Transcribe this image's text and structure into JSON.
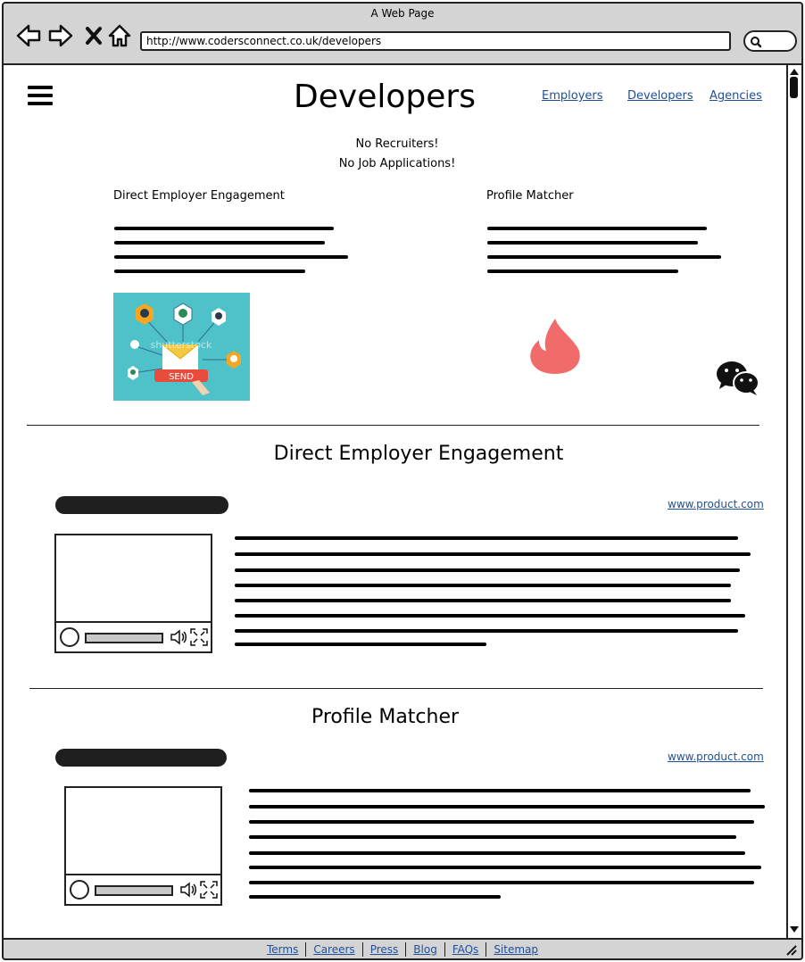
{
  "window": {
    "title": "A Web Page",
    "url": "http://www.codersconnect.co.uk/developers"
  },
  "header": {
    "title": "Developers",
    "nav": [
      "Employers",
      "Developers",
      "Agencies"
    ]
  },
  "taglines": [
    "No Recruiters!",
    "No Job Applications!"
  ],
  "features": {
    "left_heading": "Direct Employer Engagement",
    "right_heading": "Profile Matcher",
    "illustration_send_label": "SEND",
    "illustration_watermark": "shutterstock"
  },
  "sections": [
    {
      "title": "Direct Employer Engagement",
      "link": "www.product.com"
    },
    {
      "title": "Profile Matcher",
      "link": "www.product.com"
    }
  ],
  "footer": {
    "links": [
      "Terms",
      "Careers",
      "Press",
      "Blog",
      "FAQs",
      "Sitemap"
    ]
  },
  "colors": {
    "link": "#1f4f9a",
    "chrome": "#d4d4d4",
    "tinder_flame": "#f16b6b",
    "illustration_bg": "#4fc1c9"
  },
  "icons": [
    "back-arrow-icon",
    "forward-arrow-icon",
    "close-icon",
    "home-icon",
    "search-icon",
    "hamburger-menu-icon",
    "flame-icon",
    "wechat-icon",
    "play-icon",
    "volume-icon",
    "fullscreen-icon"
  ]
}
